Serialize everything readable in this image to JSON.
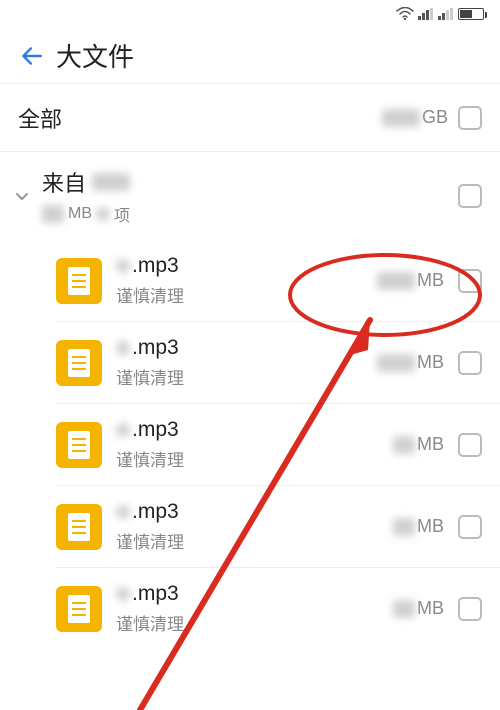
{
  "status": {
    "wifi": true,
    "signal": true
  },
  "header": {
    "title": "大文件"
  },
  "all_row": {
    "label": "全部",
    "size_unit": "GB"
  },
  "group": {
    "prefix": "来自",
    "size_unit": "MB",
    "count_unit": "项"
  },
  "items": [
    {
      "ext": ".mp3",
      "sub": "谨慎清理",
      "size_unit": "MB"
    },
    {
      "ext": ".mp3",
      "sub": "谨慎清理",
      "size_unit": "MB"
    },
    {
      "ext": ".mp3",
      "sub": "谨慎清理",
      "size_unit": "MB"
    },
    {
      "ext": ".mp3",
      "sub": "谨慎清理",
      "size_unit": "MB"
    },
    {
      "ext": ".mp3",
      "sub": "谨慎清理",
      "size_unit": "MB"
    }
  ],
  "colors": {
    "accent": "#2a7de1",
    "file_icon": "#f4b400",
    "annotation": "#d92b1f"
  }
}
